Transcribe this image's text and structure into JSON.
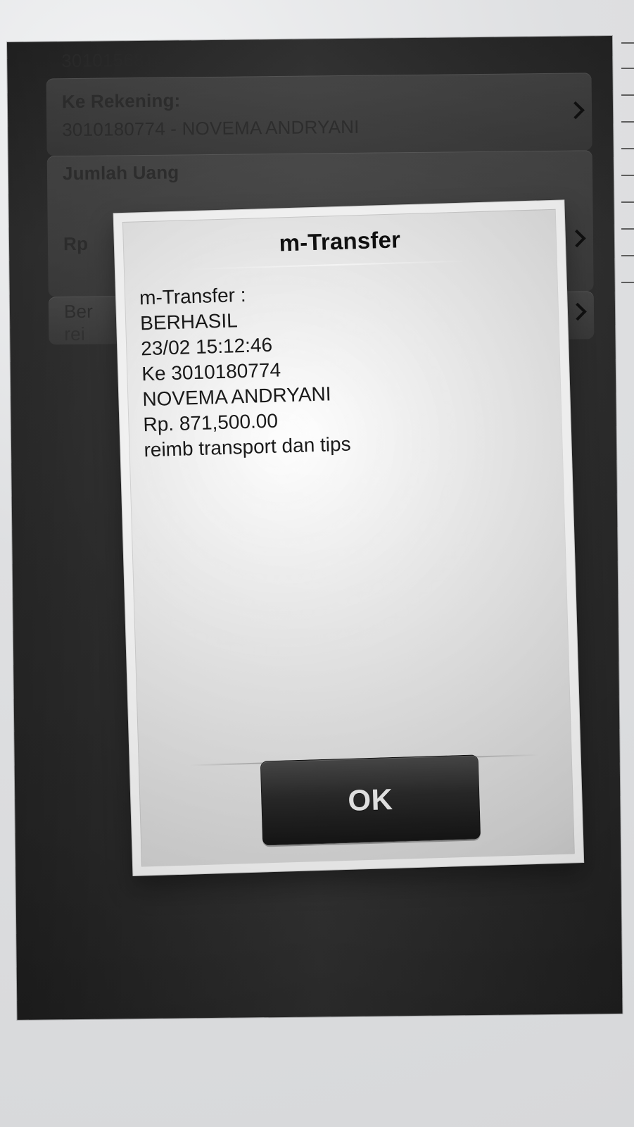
{
  "background_form": {
    "account_top_partial": "3010156814",
    "to_account_label": "Ke Rekening:",
    "to_account_value": "3010180774 - NOVEMA ANDRYANI",
    "amount_label": "Jumlah Uang",
    "currency_prefix": "Rp",
    "description_prefix_partial": "Ber",
    "description_value_partial": "rei"
  },
  "dialog": {
    "title": "m-Transfer",
    "message_lines": [
      "m-Transfer :",
      "BERHASIL",
      "23/02 15:12:46",
      "Ke 3010180774",
      "NOVEMA ANDRYANI",
      "Rp. 871,500.00",
      "reimb transport dan tips"
    ],
    "ok_label": "OK"
  },
  "icons": {
    "chevron": "chevron-right-icon"
  }
}
